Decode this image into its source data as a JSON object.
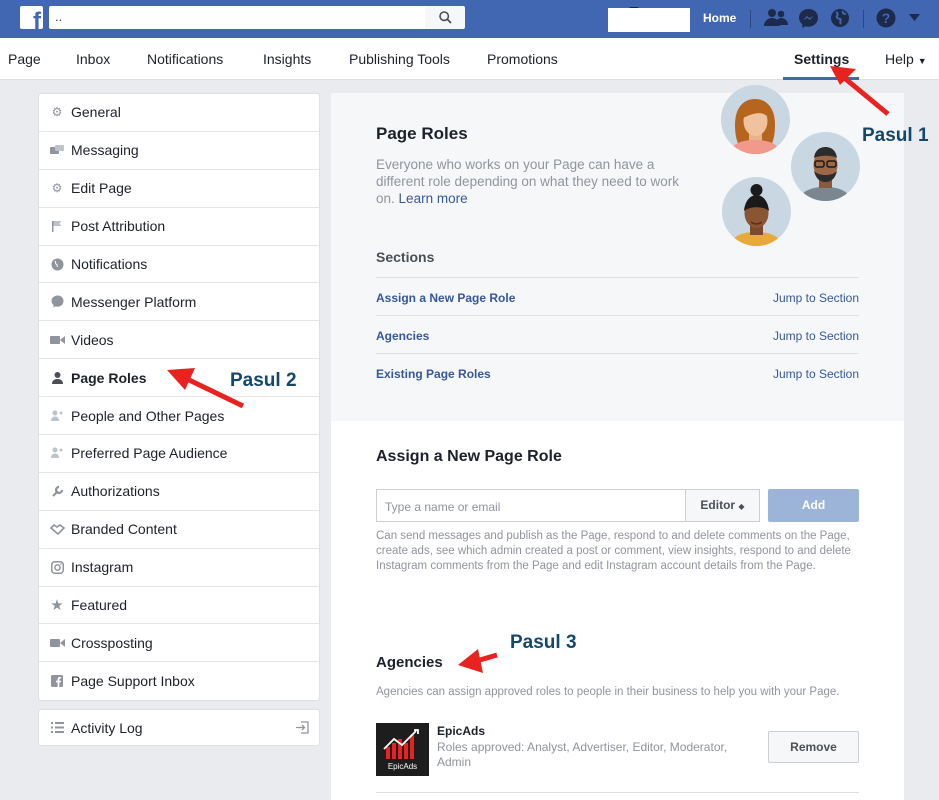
{
  "topbar": {
    "logo": "f",
    "search_value": "..",
    "home_label": "Home",
    "icons": [
      "friends-icon",
      "messenger-icon",
      "globe-icon",
      "help-icon",
      "caret-down-icon"
    ]
  },
  "nav": {
    "items": [
      "Page",
      "Inbox",
      "Notifications",
      "Insights",
      "Publishing Tools",
      "Promotions",
      "Settings",
      "Help"
    ]
  },
  "sidebar": {
    "items": [
      {
        "label": "General",
        "icon": "gear-icon"
      },
      {
        "label": "Messaging",
        "icon": "chat-icon"
      },
      {
        "label": "Edit Page",
        "icon": "gear-icon"
      },
      {
        "label": "Post Attribution",
        "icon": "flag-icon"
      },
      {
        "label": "Notifications",
        "icon": "globe-icon"
      },
      {
        "label": "Messenger Platform",
        "icon": "messenger-icon"
      },
      {
        "label": "Videos",
        "icon": "video-icon"
      },
      {
        "label": "Page Roles",
        "icon": "person-icon"
      },
      {
        "label": "People and Other Pages",
        "icon": "people-icon"
      },
      {
        "label": "Preferred Page Audience",
        "icon": "people-icon"
      },
      {
        "label": "Authorizations",
        "icon": "wrench-icon"
      },
      {
        "label": "Branded Content",
        "icon": "handshake-icon"
      },
      {
        "label": "Instagram",
        "icon": "instagram-icon"
      },
      {
        "label": "Featured",
        "icon": "star-icon"
      },
      {
        "label": "Crossposting",
        "icon": "video-icon"
      },
      {
        "label": "Page Support Inbox",
        "icon": "facebook-icon"
      }
    ],
    "activity_log": "Activity Log"
  },
  "page_roles": {
    "title": "Page Roles",
    "description": "Everyone who works on your Page can have a different role depending on what they need to work on.",
    "learn_more": "Learn more",
    "sections_title": "Sections",
    "sections": [
      {
        "label": "Assign a New Page Role",
        "jump": "Jump to Section"
      },
      {
        "label": "Agencies",
        "jump": "Jump to Section"
      },
      {
        "label": "Existing Page Roles",
        "jump": "Jump to Section"
      }
    ]
  },
  "assign": {
    "title": "Assign a New Page Role",
    "placeholder": "Type a name or email",
    "role": "Editor",
    "add_label": "Add",
    "permissions": "Can send messages and publish as the Page, respond to and delete comments on the Page, create ads, see which admin created a post or comment, view insights, respond to and delete Instagram comments from the Page and edit Instagram account details from the Page."
  },
  "agencies": {
    "title": "Agencies",
    "description": "Agencies can assign approved roles to people in their business to help you with your Page.",
    "agency_name": "EpicAds",
    "logo_text": "EpicAds",
    "roles": "Roles approved: Analyst, Advertiser, Editor, Moderator, Admin",
    "remove_label": "Remove"
  },
  "annotations": {
    "step1": "Pasul 1",
    "step2": "Pasul 2",
    "step3": "Pasul 3"
  },
  "colors": {
    "brand": "#4267b2",
    "link": "#365899",
    "annotation_text": "#12486b",
    "arrow": "#e8231f"
  }
}
